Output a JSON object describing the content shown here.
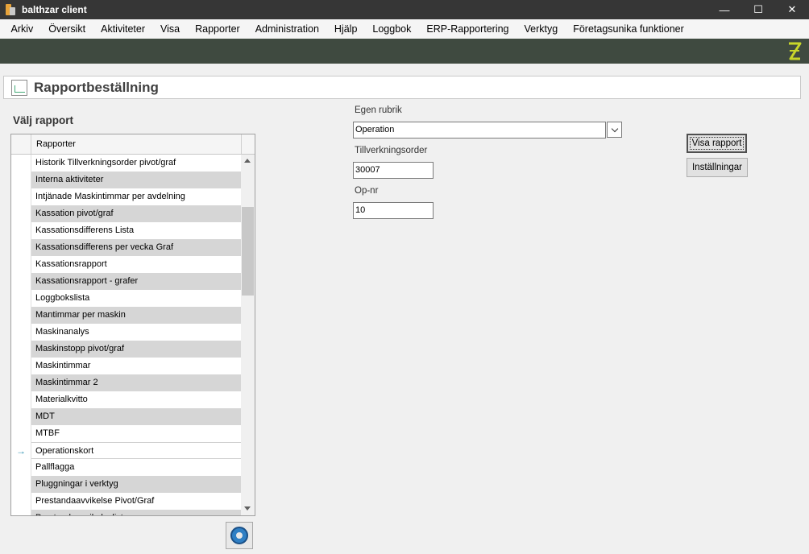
{
  "window": {
    "title": "balthzar client"
  },
  "menu": [
    "Arkiv",
    "Översikt",
    "Aktiviteter",
    "Visa",
    "Rapporter",
    "Administration",
    "Hjälp",
    "Loggbok",
    "ERP-Rapportering",
    "Verktyg",
    "Företagsunika funktioner"
  ],
  "page": {
    "title": "Rapportbeställning",
    "section_label": "Välj rapport"
  },
  "grid": {
    "column_header": "Rapporter",
    "selected_index": 17,
    "rows": [
      "Historik Tillverkningsorder pivot/graf",
      "Interna aktiviteter",
      "Intjänade Maskintimmar per avdelning",
      "Kassation pivot/graf",
      "Kassationsdifferens Lista",
      "Kassationsdifferens per vecka Graf",
      "Kassationsrapport",
      "Kassationsrapport - grafer",
      "Loggbokslista",
      "Mantimmar per maskin",
      "Maskinanalys",
      "Maskinstopp pivot/graf",
      "Maskintimmar",
      "Maskintimmar 2",
      "Materialkvitto",
      "MDT",
      "MTBF",
      "Operationskort",
      "Pallflagga",
      "Pluggningar i verktyg",
      "Prestandaavvikelse Pivot/Graf",
      "Prestandaavvikelselista"
    ]
  },
  "form": {
    "egen_rubrik_label": "Egen rubrik",
    "egen_rubrik_value": "Operation",
    "tillverkningsorder_label": "Tillverkningsorder",
    "tillverkningsorder_value": "30007",
    "opnr_label": "Op-nr",
    "opnr_value": "10"
  },
  "buttons": {
    "visa_rapport": "Visa rapport",
    "installningar": "Inställningar"
  },
  "colors": {
    "titlebar": "#363636",
    "banner": "#3f4a40",
    "logo": "#c8d62a",
    "row_alt": "#d6d6d6"
  }
}
